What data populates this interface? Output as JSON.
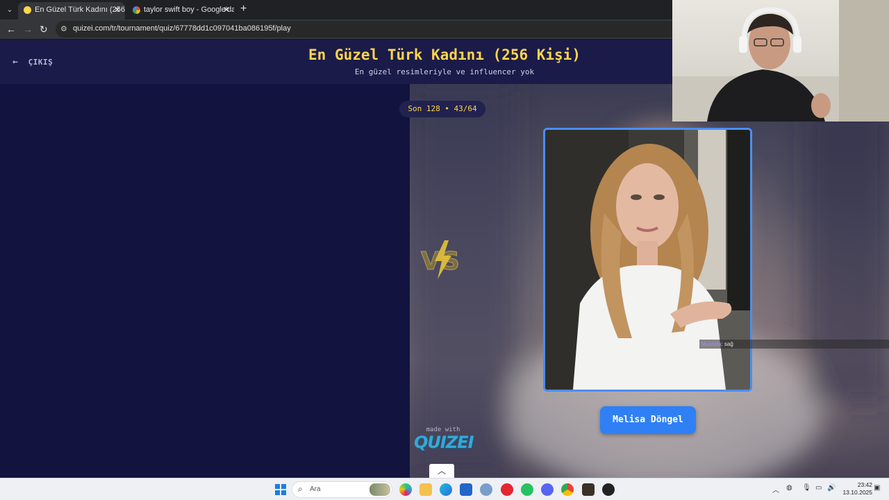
{
  "browser": {
    "tabs": [
      {
        "title": "En Güzel Türk Kadını (256 Kişi)",
        "active": true
      },
      {
        "title": "taylor swift boy - Google'da Ar...",
        "active": false
      }
    ],
    "url": "quizei.com/tr/tournament/quiz/67778dd1c097041ba086195f/play"
  },
  "page": {
    "exit_label": "ÇIKIŞ",
    "title": "En Güzel Türk Kadını (256 Kişi)",
    "subtitle": "En güzel resimleriyle ve influencer yok",
    "round_label": "Son 128 • 43/64",
    "vs_label": "VS",
    "contestant_name": "Melisa Döngel",
    "made_with": "made with",
    "brand": "QUIZEI"
  },
  "chat": {
    "user": "Mustafa",
    "message": ": sağ"
  },
  "taskbar": {
    "search_placeholder": "Ara",
    "time": "23:42",
    "date": "13.10.2025"
  },
  "colors": {
    "title": "#ffd54a",
    "accent_blue": "#2f80f5",
    "page_bg": "#13133f"
  }
}
